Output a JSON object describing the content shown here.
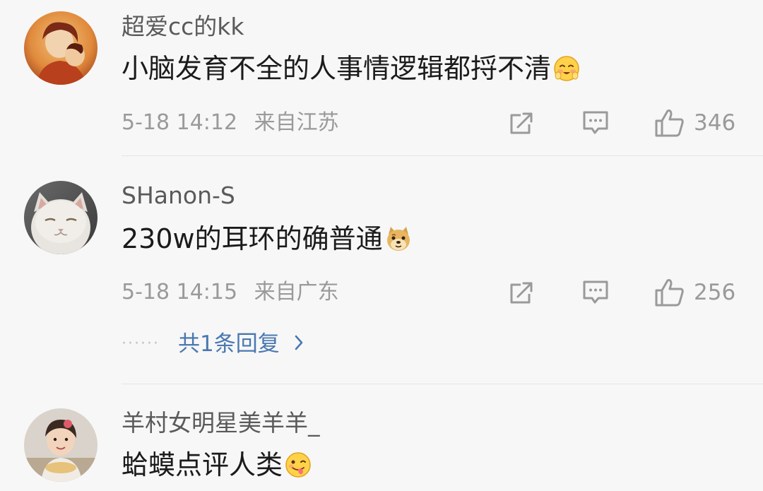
{
  "comments": [
    {
      "username": "超爱cc的kk",
      "text": "小脑发育不全的人事情逻辑都捋不清",
      "emoji": "blush-face-emoji",
      "date": "5-18 14:12",
      "location": "来自江苏",
      "likes": "346"
    },
    {
      "username": "SHanon-S",
      "text": "230w的耳环的确普通",
      "emoji": "doge-emoji",
      "date": "5-18 14:15",
      "location": "来自广东",
      "likes": "256",
      "replies": {
        "dots": "······",
        "label": "共1条回复"
      }
    },
    {
      "username": "羊村女明星美羊羊_",
      "text": "蛤蟆点评人类",
      "emoji": "tongue-face-emoji"
    }
  ],
  "colors": {
    "background": "#f7f7f7",
    "username": "#5a5a5a",
    "text": "#1b1b1b",
    "meta": "#9a9a9a",
    "link": "#4a78b0",
    "divider": "#e4e4e4"
  },
  "icons": {
    "share": "share-icon",
    "comment": "comment-icon",
    "like": "thumbs-up-icon",
    "chevron": "chevron-right-icon"
  }
}
